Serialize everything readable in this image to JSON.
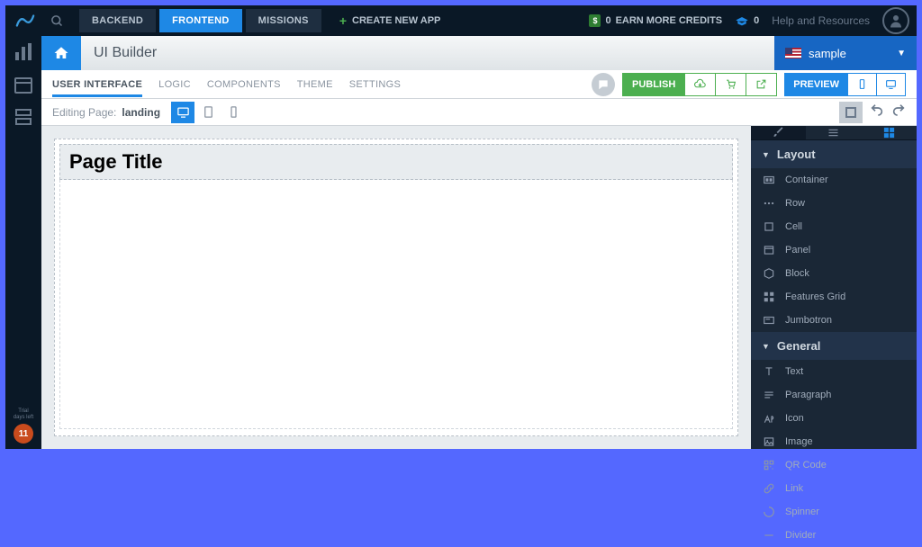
{
  "top": {
    "tabs": [
      "BACKEND",
      "FRONTEND",
      "MISSIONS"
    ],
    "active_tab": 1,
    "create": "CREATE NEW APP",
    "credits_label": "EARN MORE CREDITS",
    "credits_value": "0",
    "grad_value": "0",
    "help": "Help and Resources"
  },
  "titlebar": {
    "title": "UI Builder",
    "dropdown": "sample"
  },
  "subnav": {
    "tabs": [
      "USER INTERFACE",
      "LOGIC",
      "COMPONENTS",
      "THEME",
      "SETTINGS"
    ],
    "active": 0,
    "publish": "PUBLISH",
    "preview": "PREVIEW"
  },
  "editbar": {
    "label": "Editing Page:",
    "value": "landing"
  },
  "canvas": {
    "heading": "Page Title"
  },
  "panel": {
    "sections": [
      {
        "name": "Layout",
        "items": [
          "Container",
          "Row",
          "Cell",
          "Panel",
          "Block",
          "Features Grid",
          "Jumbotron"
        ]
      },
      {
        "name": "General",
        "items": [
          "Text",
          "Paragraph",
          "Icon",
          "Image",
          "QR Code",
          "Link",
          "Spinner",
          "Divider"
        ]
      }
    ]
  },
  "trial": {
    "label": "Trial\ndays left",
    "days": "11"
  }
}
